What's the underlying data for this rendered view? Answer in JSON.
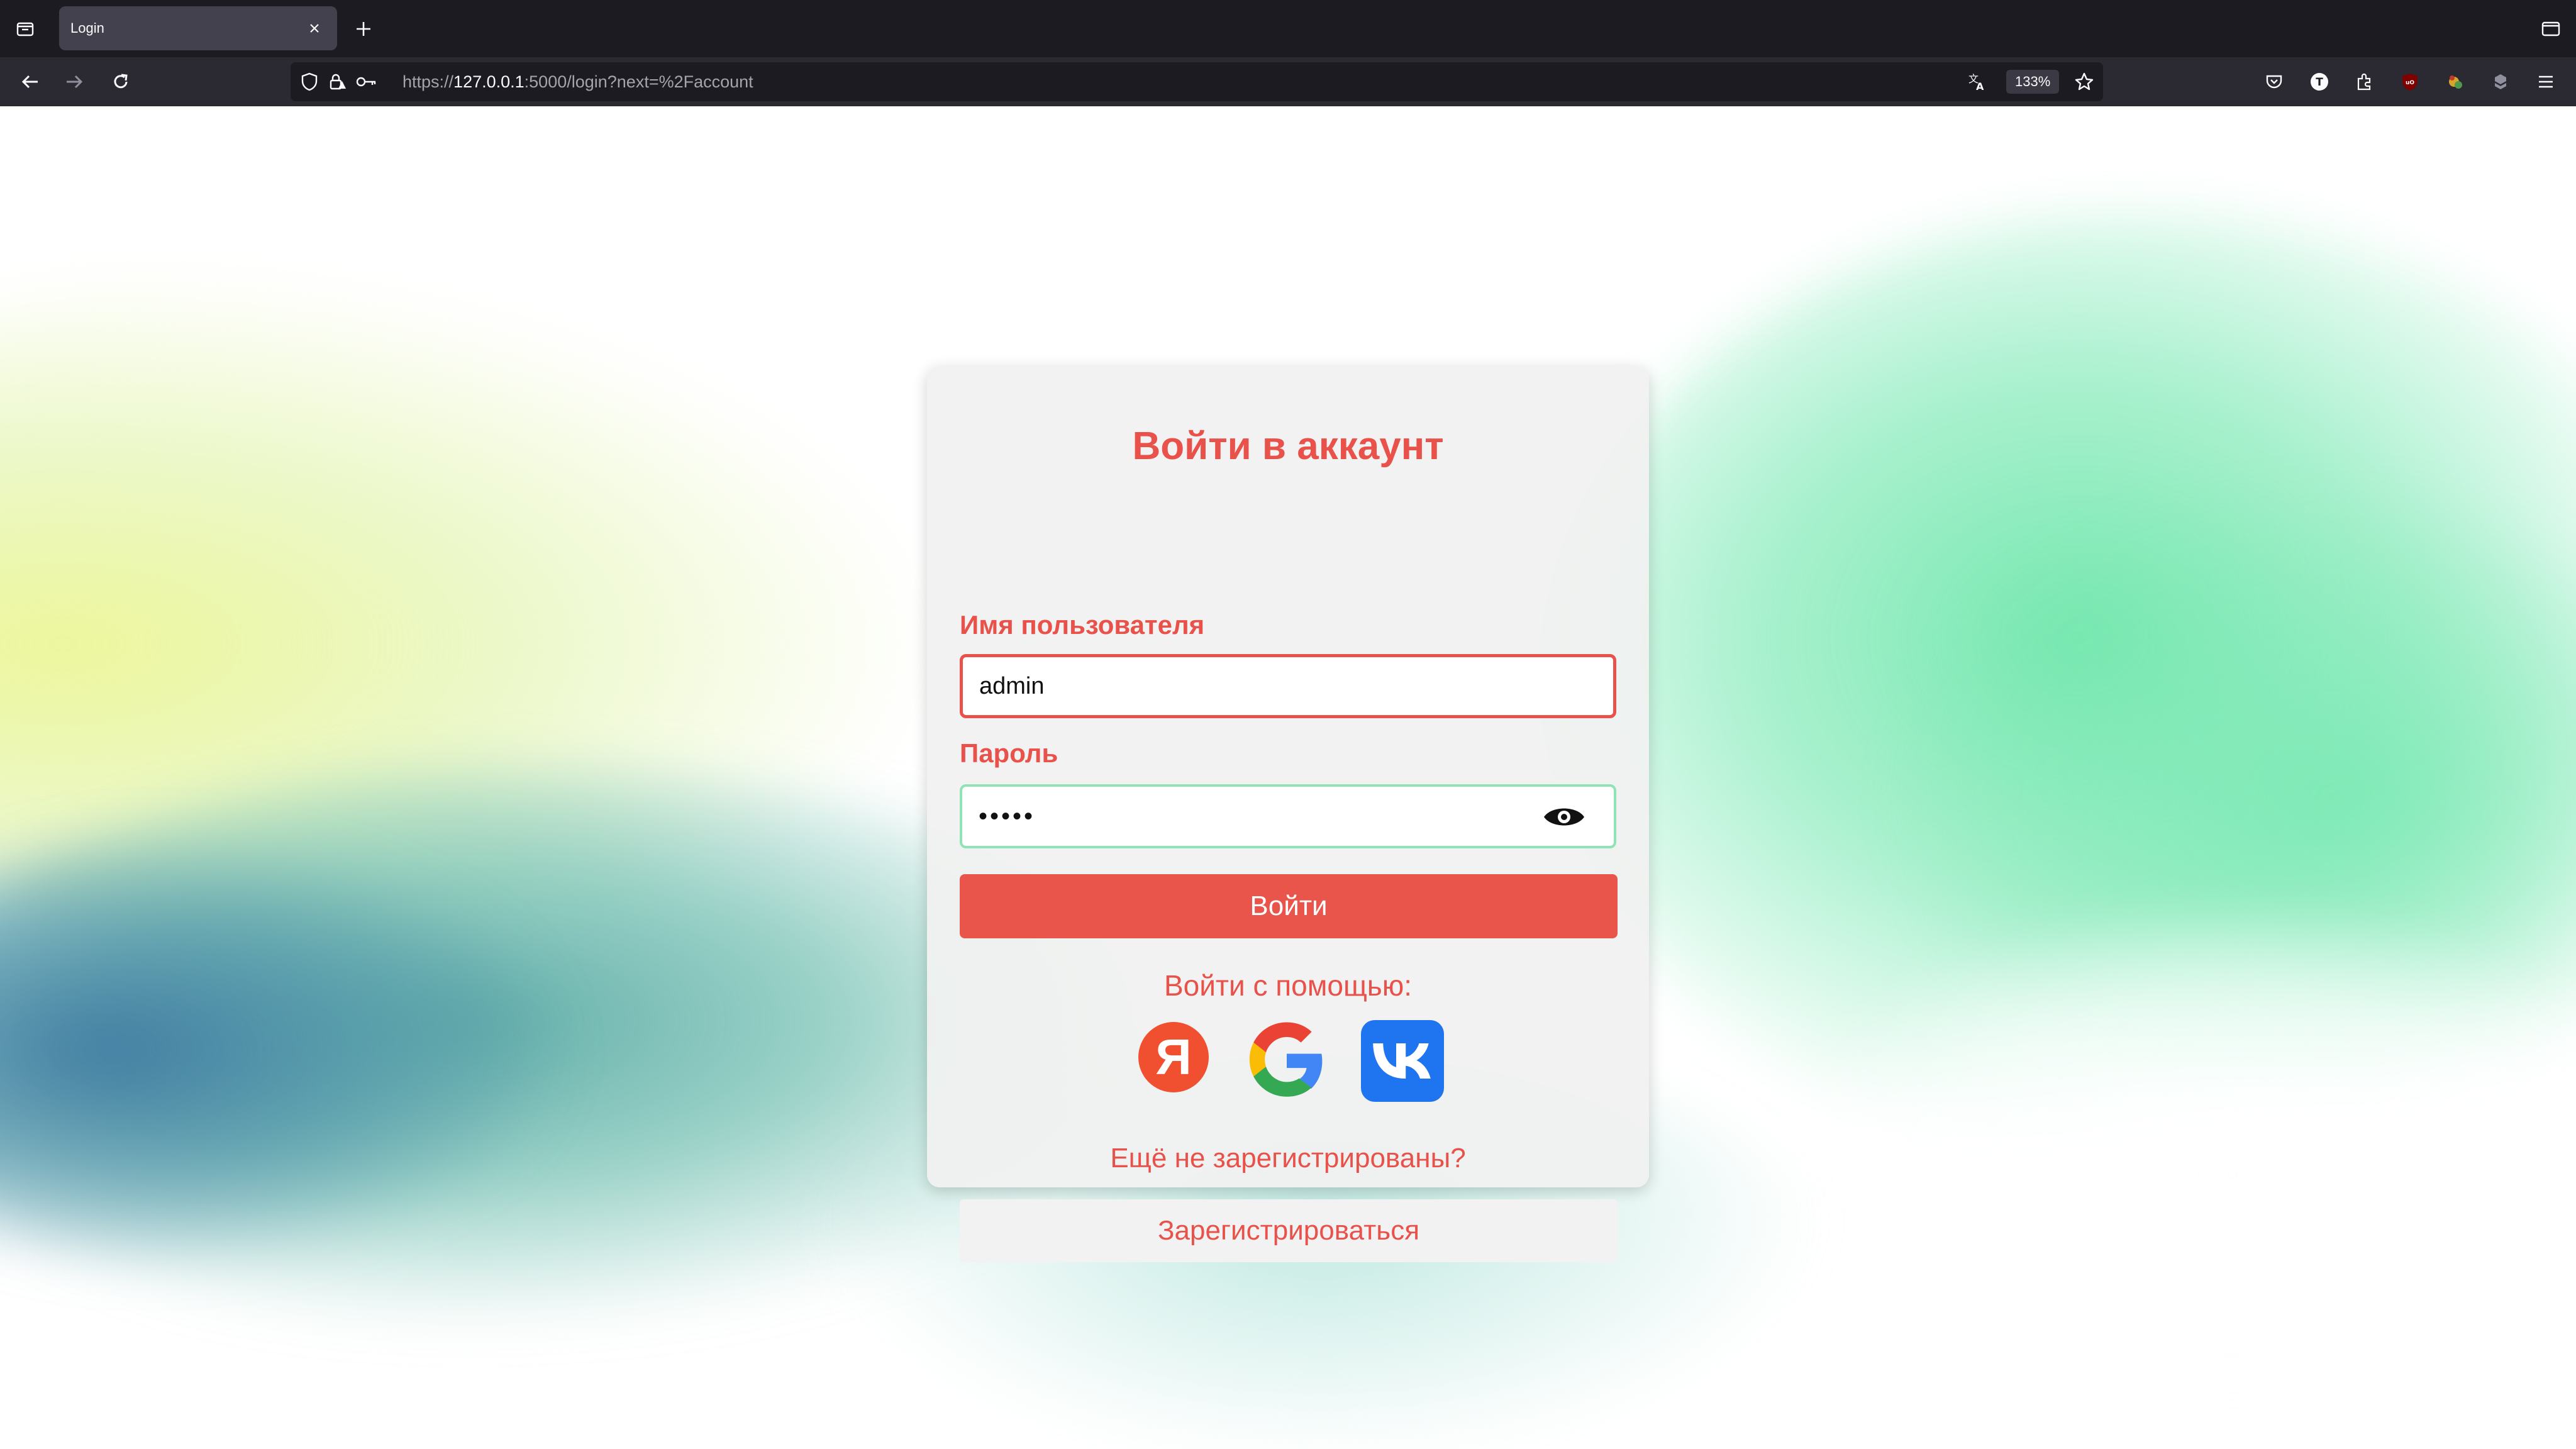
{
  "browser": {
    "tab_title": "Login",
    "url_prefix": "https://",
    "url_host": "127.0.0.1",
    "url_rest": ":5000/login?next=%2Faccount",
    "zoom": "133%"
  },
  "login": {
    "title": "Войти в аккаунт",
    "username_label": "Имя пользователя",
    "username_value": "admin",
    "password_label": "Пароль",
    "password_value": "admin",
    "submit_label": "Войти",
    "social_label": "Войти с помощью:",
    "social_providers": [
      "yandex",
      "google",
      "vk"
    ],
    "yandex_glyph": "Я",
    "register_prompt": "Ещё не зарегистрированы?",
    "register_label": "Зарегистрироваться"
  },
  "colors": {
    "accent": "#e8524a",
    "submit_bg": "#e9544b",
    "vk_blue": "#1f74f0",
    "yandex_red": "#f0502f"
  }
}
